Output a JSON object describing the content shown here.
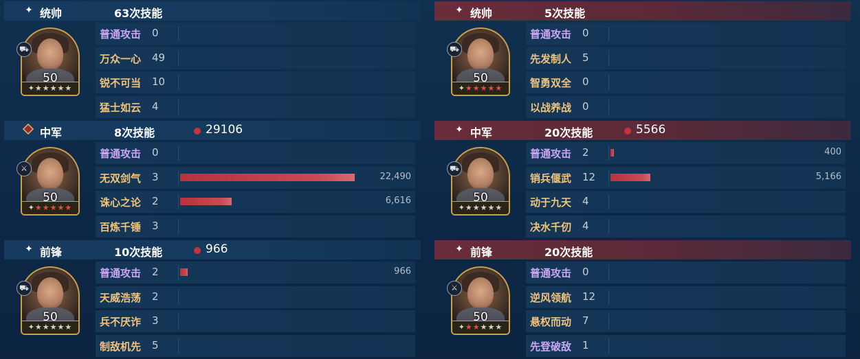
{
  "left_team": {
    "sections": [
      {
        "role": "统帅",
        "role_icon": "sparkle-icon",
        "skill_count": "63次技能",
        "damage": "",
        "portrait": {
          "level": "50",
          "stars_filled": 0,
          "badge_icon": "chariot-icon"
        },
        "skills": [
          {
            "name": "普通攻击",
            "count": "0",
            "highlight": true
          },
          {
            "name": "万众一心",
            "count": "49"
          },
          {
            "name": "锐不可当",
            "count": "10"
          },
          {
            "name": "猛士如云",
            "count": "4"
          }
        ]
      },
      {
        "role": "中军",
        "role_icon": "red-diamond-icon",
        "skill_count": "8次技能",
        "damage": "29106",
        "portrait": {
          "level": "50",
          "stars_filled": 5,
          "badge_icon": "sword-icon"
        },
        "skills": [
          {
            "name": "普通攻击",
            "count": "0",
            "highlight": true
          },
          {
            "name": "无双剑气",
            "count": "3",
            "bar_fraction": 1.0,
            "value": "22,490"
          },
          {
            "name": "诛心之论",
            "count": "2",
            "bar_fraction": 0.294,
            "value": "6,616"
          },
          {
            "name": "百炼千锤",
            "count": "3"
          }
        ]
      },
      {
        "role": "前锋",
        "role_icon": "sparkle-icon",
        "skill_count": "10次技能",
        "damage": "966",
        "portrait": {
          "level": "50",
          "stars_filled": 0,
          "badge_icon": "chariot-icon"
        },
        "skills": [
          {
            "name": "普通攻击",
            "count": "2",
            "highlight": true,
            "bar_fraction": 0.043,
            "value": "966"
          },
          {
            "name": "天威浩荡",
            "count": "2"
          },
          {
            "name": "兵不厌诈",
            "count": "3"
          },
          {
            "name": "制敌机先",
            "count": "5"
          }
        ]
      }
    ]
  },
  "right_team": {
    "sections": [
      {
        "role": "统帅",
        "role_icon": "sparkle-icon",
        "skill_count": "5次技能",
        "damage": "",
        "portrait": {
          "level": "50",
          "stars_filled": 5,
          "badge_icon": "chariot-icon"
        },
        "skills": [
          {
            "name": "普通攻击",
            "count": "0",
            "highlight": true
          },
          {
            "name": "先发制人",
            "count": "5"
          },
          {
            "name": "智勇双全",
            "count": "0"
          },
          {
            "name": "以战养战",
            "count": "0"
          }
        ]
      },
      {
        "role": "中军",
        "role_icon": "sparkle-icon",
        "skill_count": "20次技能",
        "damage": "5566",
        "portrait": {
          "level": "50",
          "stars_filled": 0,
          "badge_icon": "chariot-icon"
        },
        "skills": [
          {
            "name": "普通攻击",
            "count": "2",
            "highlight": true,
            "bar_fraction": 0.018,
            "value": "400"
          },
          {
            "name": "销兵偃武",
            "count": "12",
            "bar_fraction": 0.23,
            "value": "5,166"
          },
          {
            "name": "动于九天",
            "count": "4"
          },
          {
            "name": "决水千仞",
            "count": "4"
          }
        ]
      },
      {
        "role": "前锋",
        "role_icon": "sparkle-icon",
        "skill_count": "20次技能",
        "damage": "",
        "portrait": {
          "level": "50",
          "stars_filled": 2,
          "badge_icon": "sword-icon"
        },
        "skills": [
          {
            "name": "普通攻击",
            "count": "0",
            "highlight": true
          },
          {
            "name": "逆风领航",
            "count": "12"
          },
          {
            "name": "悬权而动",
            "count": "7"
          },
          {
            "name": "先登破敌",
            "count": "1",
            "highlight": true
          }
        ]
      }
    ]
  },
  "colors": {
    "left_header": "#163b5e",
    "right_header": "#6a2d3b",
    "skill_name": "#f0c27b",
    "skill_name_highlight": "#c9a7f5",
    "damage_bar": "#b8323c",
    "damage_dot": "#c8323c",
    "star_on": "#e84a4a",
    "star_off": "#d9d4c8"
  }
}
